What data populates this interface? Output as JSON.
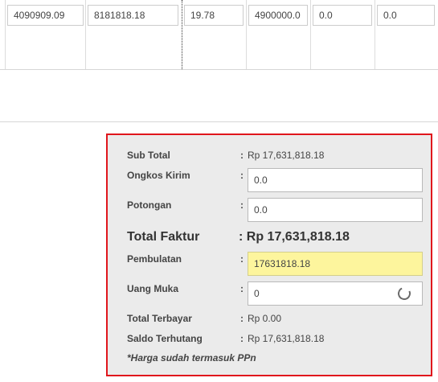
{
  "grid_row": {
    "cells": [
      "4090909.09",
      "8181818.18",
      "19.78",
      "4900000.0",
      "0.0",
      "0.0"
    ]
  },
  "summary": {
    "sub_total": {
      "label": "Sub Total",
      "colon": ":",
      "value": "Rp 17,631,818.18"
    },
    "ongkos_kirim": {
      "label": "Ongkos Kirim",
      "colon": ":",
      "value": "0.0"
    },
    "potongan": {
      "label": "Potongan",
      "colon": ":",
      "value": "0.0"
    },
    "total_faktur": {
      "label": "Total Faktur",
      "value": ": Rp 17,631,818.18"
    },
    "pembulatan": {
      "label": "Pembulatan",
      "colon": ":",
      "value": "17631818.18"
    },
    "uang_muka": {
      "label": "Uang Muka",
      "colon": ":",
      "value": "0"
    },
    "total_terbayar": {
      "label": "Total Terbayar",
      "colon": ":",
      "value": "Rp 0.00"
    },
    "saldo_terhutang": {
      "label": "Saldo Terhutang",
      "colon": ":",
      "value": "Rp 17,631,818.18"
    },
    "note": "*Harga sudah termasuk PPn"
  },
  "colors": {
    "highlight_border": "#e0161c",
    "rounding_field_bg": "#fdf59d",
    "panel_bg": "#ebebeb"
  },
  "icons": {
    "uang_muka_loading": "loading-spinner-icon"
  }
}
